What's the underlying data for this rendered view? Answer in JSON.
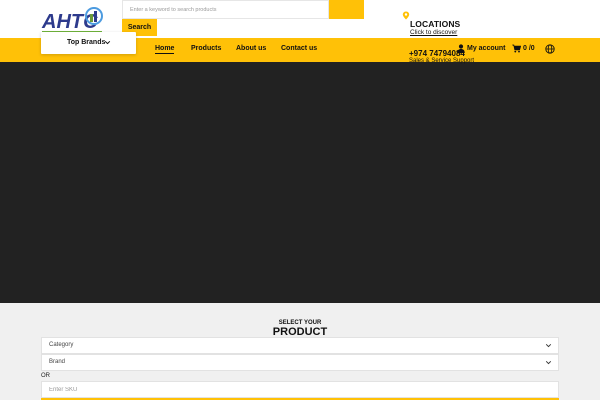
{
  "header": {
    "search": {
      "placeholder": "Enter a keyword to search products",
      "button_label": "Search"
    },
    "location": {
      "title": "LOCATIONS",
      "link": "Click to discover"
    },
    "brands": {
      "label": "Top Brands"
    },
    "nav": [
      {
        "label": "Home",
        "active": true
      },
      {
        "label": "Products",
        "active": false
      },
      {
        "label": "About us",
        "active": false
      },
      {
        "label": "Contact us",
        "active": false
      }
    ],
    "phone": "+974 74794084",
    "support": "Sales & Service Support",
    "account_label": "My account",
    "cart_label": "0 /0"
  },
  "colors": {
    "accent": "#ffc107",
    "hero": "#222222",
    "selector_bg": "#f0f0f0"
  },
  "selector": {
    "small_title": "SELECT YOUR",
    "big_title": "PRODUCT",
    "category_label": "Category",
    "brand_label": "Brand",
    "or_label": "OR",
    "sku_placeholder": "Enter SKU"
  },
  "icons": [
    "logo",
    "location-pin-icon",
    "chevron-down-icon",
    "user-icon",
    "cart-icon",
    "globe-icon"
  ]
}
